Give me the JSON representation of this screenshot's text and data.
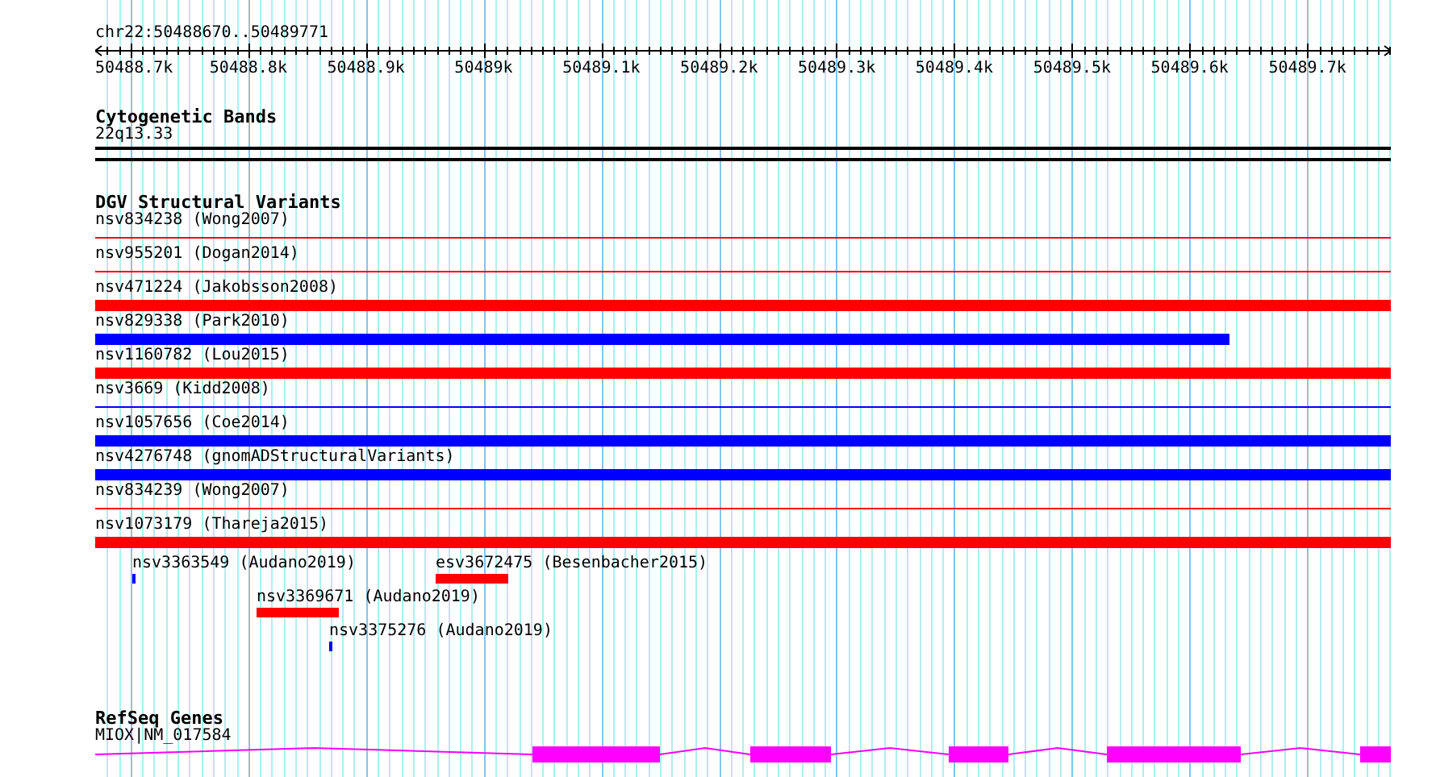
{
  "ruler": {
    "range": "chr22:50488670..50489771",
    "labels": [
      "50488.7k",
      "50488.8k",
      "50488.9k",
      "50489k",
      "50489.1k",
      "50489.2k",
      "50489.3k",
      "50489.4k",
      "50489.5k",
      "50489.6k",
      "50489.7k"
    ]
  },
  "cytogenetic_bands": {
    "title": "Cytogenetic Bands",
    "band": "22q13.33"
  },
  "dgv": {
    "title": "DGV Structural Variants",
    "rows": [
      {
        "label": "nsv834238 (Wong2007)",
        "color": "#ff0000",
        "kind": "thin"
      },
      {
        "label": "nsv955201 (Dogan2014)",
        "color": "#ff0000",
        "kind": "thin"
      },
      {
        "label": "nsv471224 (Jakobsson2008)",
        "color": "#ff0000",
        "kind": "thick"
      },
      {
        "label": "nsv829338 (Park2010)",
        "color": "#0000ff",
        "kind": "thick"
      },
      {
        "label": "nsv1160782 (Lou2015)",
        "color": "#ff0000",
        "kind": "thick"
      },
      {
        "label": "nsv3669 (Kidd2008)",
        "color": "#0000ff",
        "kind": "thin"
      },
      {
        "label": "nsv1057656 (Coe2014)",
        "color": "#0000ff",
        "kind": "thick"
      },
      {
        "label": "nsv4276748 (gnomADStructuralVariants)",
        "color": "#0000ff",
        "kind": "thick"
      },
      {
        "label": "nsv834239 (Wong2007)",
        "color": "#ff0000",
        "kind": "thin"
      },
      {
        "label": "nsv1073179 (Thareja2015)",
        "color": "#ff0000",
        "kind": "thick"
      }
    ],
    "small_variants": [
      {
        "label": "nsv3363549 (Audano2019)",
        "color": "#0000ff"
      },
      {
        "label": "esv3672475 (Besenbacher2015)",
        "color": "#ff0000"
      },
      {
        "label": "nsv3369671 (Audano2019)",
        "color": "#ff0000"
      },
      {
        "label": "nsv3375276 (Audano2019)",
        "color": "#0000ff"
      }
    ]
  },
  "refseq": {
    "title": "RefSeq Genes",
    "gene": "MIOX|NM_017584"
  }
}
